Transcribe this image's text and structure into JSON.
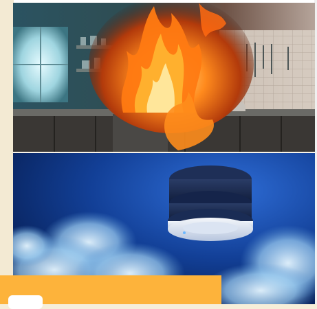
{
  "page": {
    "background_color": "#f6eed9",
    "images": [
      {
        "name": "kitchen-fire-photo",
        "alt": ""
      },
      {
        "name": "smoke-detector-photo",
        "alt": ""
      }
    ],
    "banner": {
      "color": "#fdb33b",
      "button_label": ""
    }
  }
}
